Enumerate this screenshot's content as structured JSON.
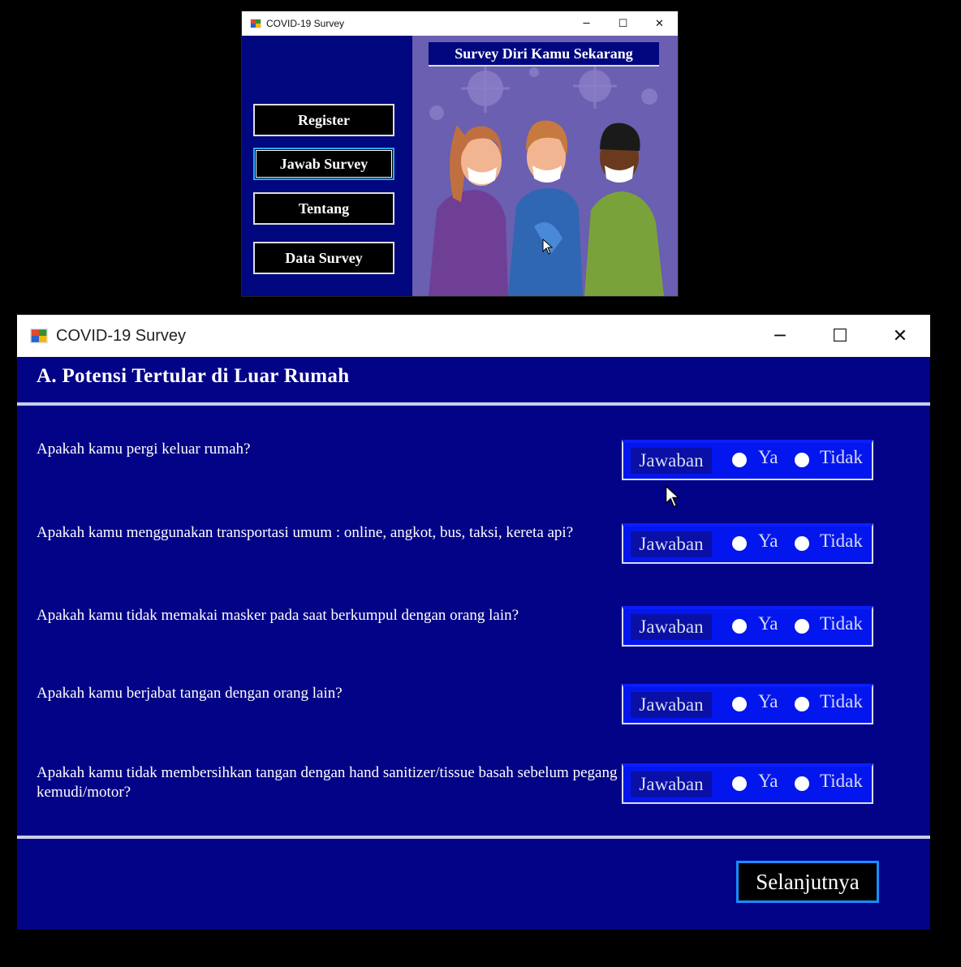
{
  "main_window": {
    "title": "COVID-19 Survey",
    "menu": [
      "Register",
      "Jawab Survey",
      "Tentang",
      "Data Survey"
    ],
    "active_menu": "Jawab Survey",
    "banner_title": "Survey Diri Kamu Sekarang"
  },
  "survey_window": {
    "title": "COVID-19 Survey",
    "section_title": "A. Potensi Tertular di Luar Rumah",
    "questions": [
      "Apakah kamu pergi keluar rumah?",
      "Apakah kamu menggunakan transportasi umum : online, angkot, bus, taksi, kereta api?",
      "Apakah kamu tidak memakai masker pada saat berkumpul dengan orang lain?",
      "Apakah kamu berjabat tangan dengan orang lain?",
      "Apakah kamu tidak membersihkan tangan dengan hand sanitizer/tissue basah sebelum pegang kemudi/motor?"
    ],
    "answer_label": "Jawaban",
    "option_yes": "Ya",
    "option_no": "Tidak",
    "next_button": "Selanjutnya"
  },
  "colors": {
    "window_bg": "#020386",
    "answer_box": "#0416ee",
    "illustration_bg": "#6a5fb0"
  }
}
